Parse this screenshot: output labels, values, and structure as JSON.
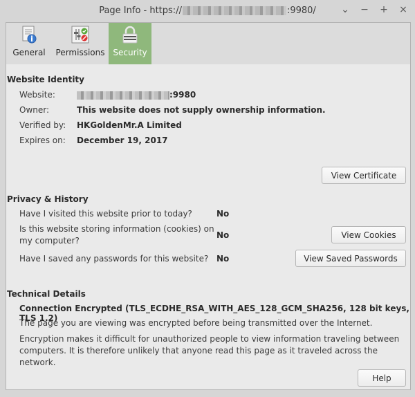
{
  "window": {
    "title_prefix": "Page Info - https://",
    "title_suffix": ":9980/",
    "controls": [
      "⌄",
      "−",
      "+",
      "×"
    ]
  },
  "toolbar": {
    "tabs": [
      {
        "label": "General",
        "icon": "page-icon"
      },
      {
        "label": "Permissions",
        "icon": "permissions-icon"
      },
      {
        "label": "Security",
        "icon": "lock-icon"
      }
    ],
    "active": "Security",
    "active_color": "#8fb87c"
  },
  "identity": {
    "title": "Website Identity",
    "website_label": "Website:",
    "website_suffix": ":9980",
    "owner_label": "Owner:",
    "owner_value": "This website does not supply ownership information.",
    "verified_label": "Verified by:",
    "verified_value": "HKGoldenMr.A Limited",
    "expires_label": "Expires on:",
    "expires_value": "December 19, 2017",
    "view_certificate": "View Certificate"
  },
  "privacy": {
    "title": "Privacy & History",
    "q1": "Have I visited this website prior to today?",
    "a1": "No",
    "q2_line1": "Is this website storing information (cookies) on",
    "q2_line2": "my computer?",
    "a2": "No",
    "view_cookies": "View Cookies",
    "q3": "Have I saved any passwords for this website?",
    "a3": "No",
    "view_passwords": "View Saved Passwords"
  },
  "technical": {
    "title": "Technical Details",
    "connection": "Connection Encrypted (TLS_ECDHE_RSA_WITH_AES_128_GCM_SHA256, 128 bit keys, TLS 1.2)",
    "para1": "The page you are viewing was encrypted before being transmitted over the Internet.",
    "para2_line1": "Encryption makes it difficult for unauthorized people to view information traveling between",
    "para2_line2": "computers. It is therefore unlikely that anyone read this page as it traveled across the network."
  },
  "footer": {
    "help": "Help"
  }
}
